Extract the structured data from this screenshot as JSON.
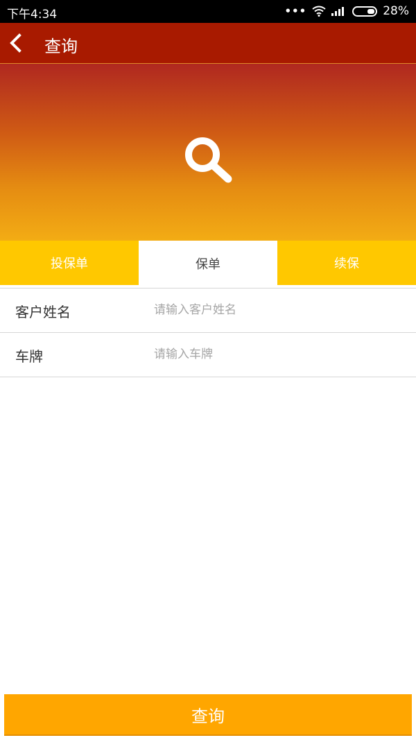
{
  "status_bar": {
    "time": "下午4:34",
    "battery": "28%"
  },
  "app_bar": {
    "title": "查询",
    "back_icon": "chevron-left-icon"
  },
  "banner": {
    "icon": "search-icon"
  },
  "tabs": [
    {
      "label": "投保单",
      "active": false
    },
    {
      "label": "保单",
      "active": true
    },
    {
      "label": "续保",
      "active": false
    }
  ],
  "form": {
    "customer_name": {
      "label": "客户姓名",
      "placeholder": "请输入客户姓名",
      "value": ""
    },
    "plate": {
      "label": "车牌",
      "placeholder": "请输入车牌",
      "value": ""
    }
  },
  "submit": {
    "label": "查询"
  },
  "colors": {
    "app_bar": "#a81a00",
    "tab_bg": "#ffc800",
    "button": "#ffa600"
  }
}
